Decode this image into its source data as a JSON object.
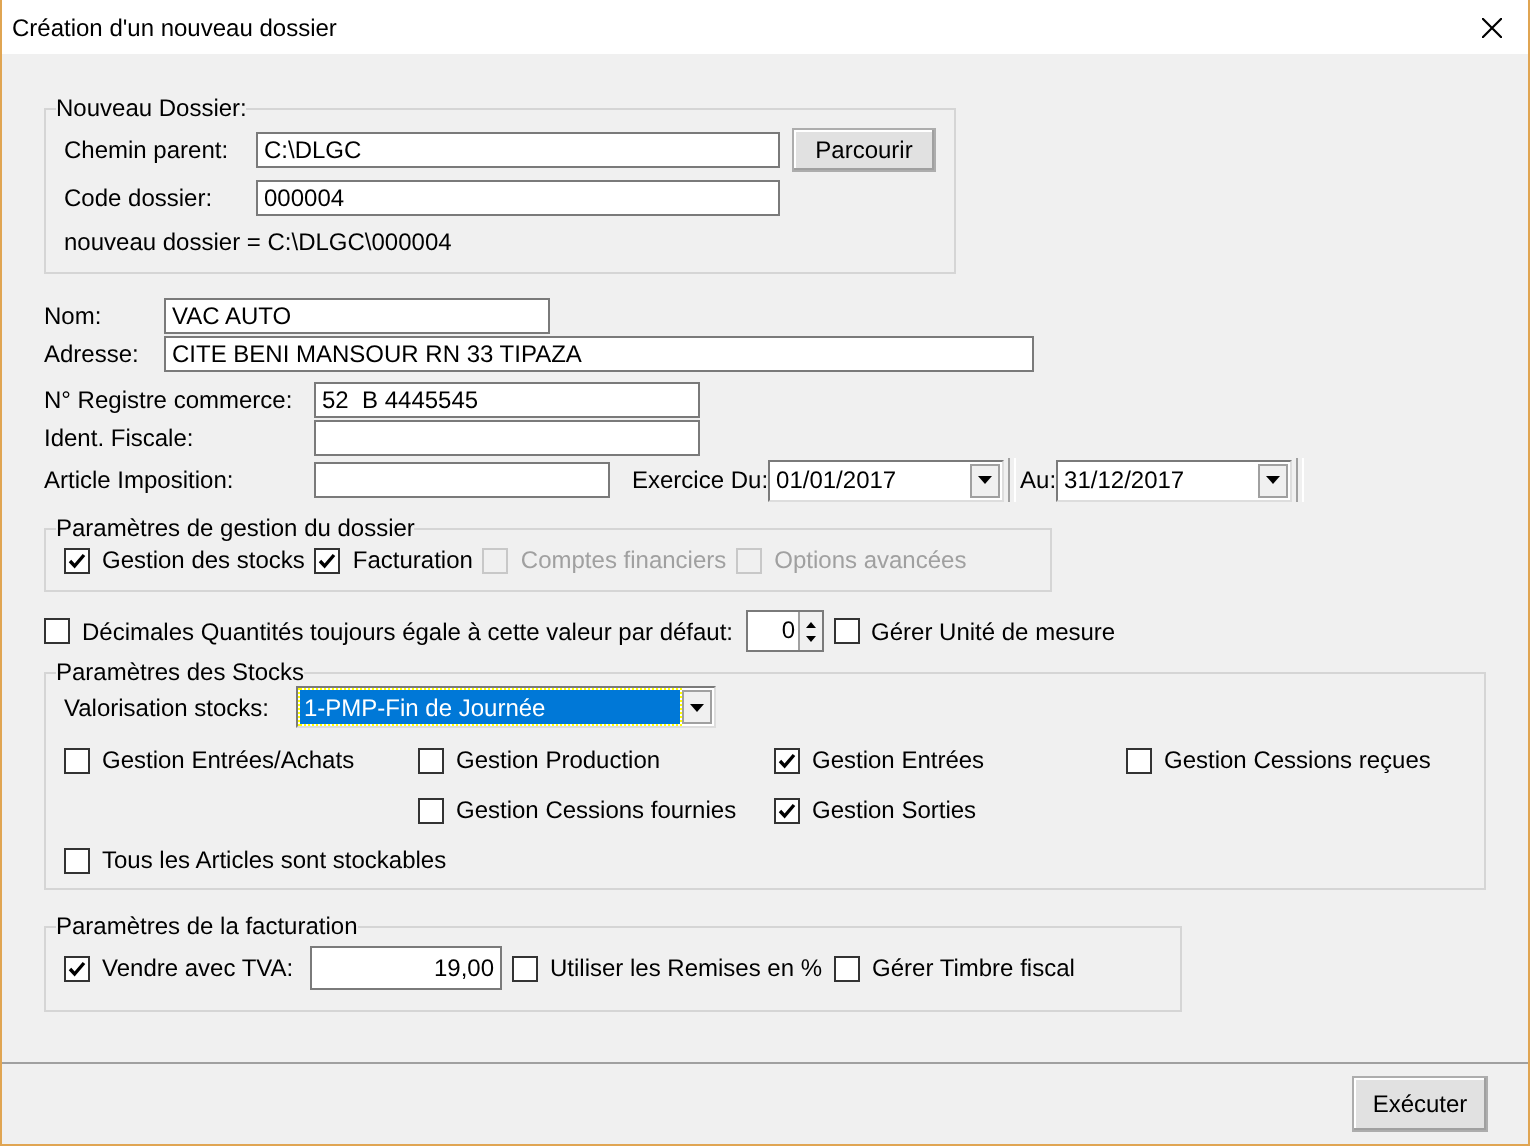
{
  "window": {
    "title": "Création d'un nouveau dossier"
  },
  "new_folder": {
    "legend": "Nouveau Dossier:",
    "parent_path": {
      "label": "Chemin parent:",
      "value": "C:\\DLGC"
    },
    "browse_button": "Parcourir",
    "folder_code": {
      "label": "Code dossier:",
      "value": "000004"
    },
    "result": "nouveau dossier = C:\\DLGC\\000004"
  },
  "company": [
    {
      "label": "Nom:",
      "value": "VAC AUTO"
    },
    {
      "label": "Adresse:",
      "value": "CITE BENI MANSOUR RN 33 TIPAZA"
    }
  ],
  "registry": [
    {
      "label": "N° Registre commerce:",
      "value": "52  B 4445545"
    },
    {
      "label": "Ident. Fiscale:"
    }
  ],
  "tax_article": {
    "label": "Article Imposition:"
  },
  "fiscal_year": {
    "from_label": "Exercice Du:",
    "from": "01/01/2017",
    "to_label": "Au:",
    "to": "31/12/2017"
  },
  "management": {
    "legend": "Paramètres de gestion du dossier",
    "options": [
      {
        "label": "Gestion des stocks",
        "checked": true,
        "disabled": false
      },
      {
        "label": "Facturation",
        "checked": true,
        "disabled": false
      },
      {
        "label": "Comptes financiers",
        "checked": false,
        "disabled": true
      },
      {
        "label": "Options avancées",
        "checked": false,
        "disabled": true
      }
    ]
  },
  "decimals": {
    "label": "Décimales Quantités toujours égale à cette valeur par défaut:",
    "checked": false,
    "value": "0"
  },
  "units": {
    "label": "Gérer Unité de mesure",
    "checked": false
  },
  "stocks": {
    "legend": "Paramètres des Stocks",
    "valuation": {
      "label": "Valorisation stocks:",
      "value": "1-PMP-Fin de Journée",
      "highlighted": true
    },
    "options": [
      {
        "label": "Gestion Entrées/Achats",
        "checked": false
      },
      {
        "label": "Gestion Production",
        "checked": false
      },
      {
        "label": "Gestion Entrées",
        "checked": true
      },
      {
        "label": "Gestion Cessions reçues",
        "checked": false
      },
      {
        "label": "Gestion Cessions fournies",
        "checked": false
      },
      {
        "label": "Gestion Sorties",
        "checked": true
      },
      {
        "label": "Tous les Articles sont stockables",
        "checked": false
      }
    ]
  },
  "billing": {
    "legend": "Paramètres de la facturation",
    "vat": {
      "label": "Vendre avec TVA:",
      "checked": true,
      "value": "19,00"
    },
    "options": [
      {
        "label": "Utiliser les Remises en %",
        "checked": false
      },
      {
        "label": "Gérer Timbre fiscal",
        "checked": false
      }
    ]
  },
  "execute_button": "Exécuter"
}
